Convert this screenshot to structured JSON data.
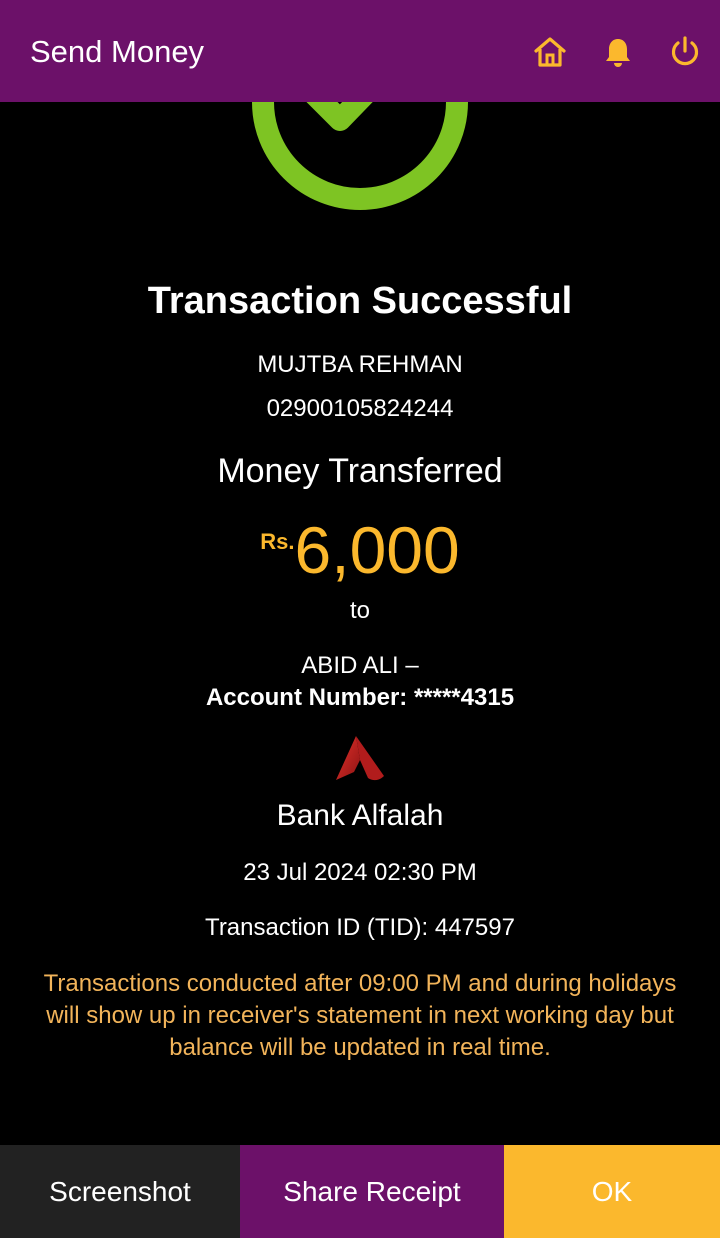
{
  "header": {
    "title": "Send Money",
    "icons": [
      "home-icon",
      "bell-icon",
      "power-icon"
    ]
  },
  "status": {
    "icon": "check-circle-icon",
    "title": "Transaction Successful"
  },
  "sender": {
    "name": "MUJTBA REHMAN",
    "account": "02900105824244"
  },
  "transfer": {
    "subtitle": "Money Transferred",
    "currency": "Rs.",
    "amount": "6,000",
    "to_label": "to"
  },
  "receiver": {
    "name": "ABID ALI –",
    "account": "Account Number: *****4315",
    "bank_icon": "bank-alfalah-logo",
    "bank": "Bank Alfalah"
  },
  "transaction": {
    "datetime": "23 Jul 2024 02:30 PM",
    "id": "Transaction ID (TID): 447597"
  },
  "note": "Transactions conducted after 09:00 PM and during holidays will show up in receiver's statement in next working day but balance will be updated in real time.",
  "buttons": {
    "screenshot": "Screenshot",
    "share": "Share Receipt",
    "ok": "OK"
  },
  "colors": {
    "header_bg": "#6c1169",
    "accent": "#fbb82d",
    "success": "#7ec423",
    "note": "#f2b45a",
    "background": "#000000"
  }
}
